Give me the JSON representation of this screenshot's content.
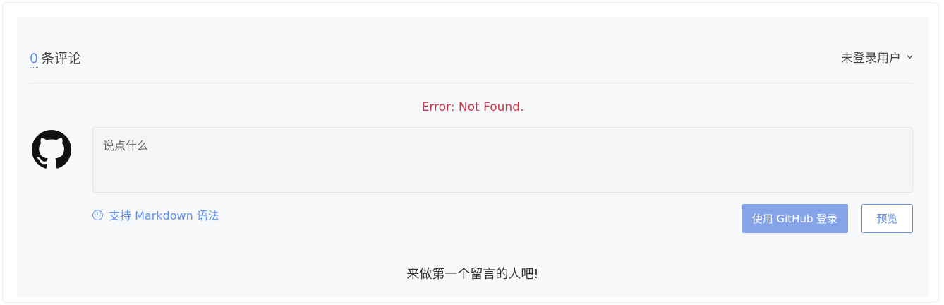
{
  "header": {
    "comment_count": "0",
    "comment_label": "条评论",
    "user_menu_label": "未登录用户"
  },
  "error_message": "Error: Not Found.",
  "editor": {
    "placeholder": "说点什么",
    "value": ""
  },
  "markdown_tip": {
    "icon": "ⓘ",
    "label": "支持 Markdown 语法"
  },
  "actions": {
    "login_label": "使用 GitHub 登录",
    "preview_label": "预览"
  },
  "empty_message": "来做第一个留言的人吧!",
  "colors": {
    "accent": "#6190e8",
    "login_button": "#85a3e8",
    "error": "#c9394d",
    "panel_bg": "#f6f8fa"
  },
  "icons": {
    "avatar": "github-icon",
    "dropdown": "chevron-down-icon",
    "info": "info-icon"
  }
}
